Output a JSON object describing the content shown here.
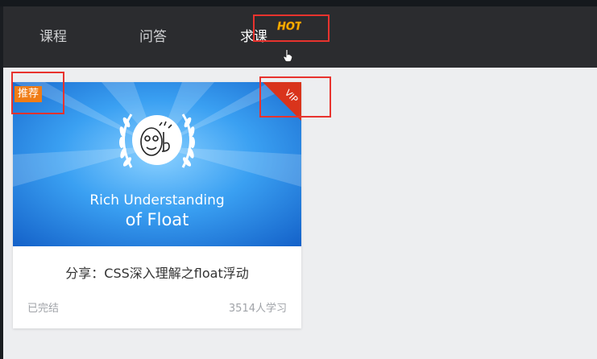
{
  "nav": {
    "items": [
      {
        "label": "课程"
      },
      {
        "label": "问答"
      },
      {
        "label": "求课",
        "badge": "HOT"
      }
    ]
  },
  "card": {
    "tag": "推荐",
    "vip_label": "VIP",
    "image_caption_line1": "Rich Understanding",
    "image_caption_line2": "of Float",
    "title": "分享：CSS深入理解之float浮动",
    "status": "已完结",
    "learners": "3514人学习"
  },
  "colors": {
    "annotation_box": "#e8332e",
    "tag_orange": "#f07c15",
    "vip_red": "#d9341c",
    "hot_yellow": "#f5b800"
  }
}
